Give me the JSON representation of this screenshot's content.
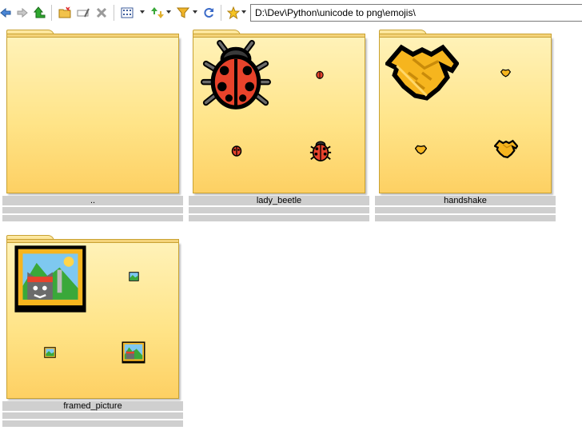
{
  "toolbar": {
    "icons": [
      "back-arrow-icon",
      "forward-arrow-icon",
      "up-folder-icon",
      "new-folder-icon",
      "rename-icon",
      "delete-icon",
      "view-mode-icon",
      "sort-icon",
      "filter-icon",
      "refresh-icon",
      "favorites-star-icon"
    ],
    "address": "D:\\Dev\\Python\\unicode to png\\emojis\\"
  },
  "folders": [
    {
      "label": "..",
      "contents": []
    },
    {
      "label": "lady_beetle",
      "contents": [
        "ladybug",
        "ladybug",
        "ladybug",
        "ladybug"
      ]
    },
    {
      "label": "handshake",
      "contents": [
        "handshake",
        "handshake",
        "handshake",
        "handshake"
      ]
    },
    {
      "label": "framed_picture",
      "contents": [
        "framed-picture",
        "framed-picture",
        "framed-picture",
        "framed-picture"
      ]
    }
  ],
  "colors": {
    "folder_light": "#fff2b8",
    "folder_dark": "#fdd063",
    "label_bar": "#cfcfcf",
    "ladybug_red": "#e8432b",
    "handshake_gold": "#f6b51e"
  }
}
